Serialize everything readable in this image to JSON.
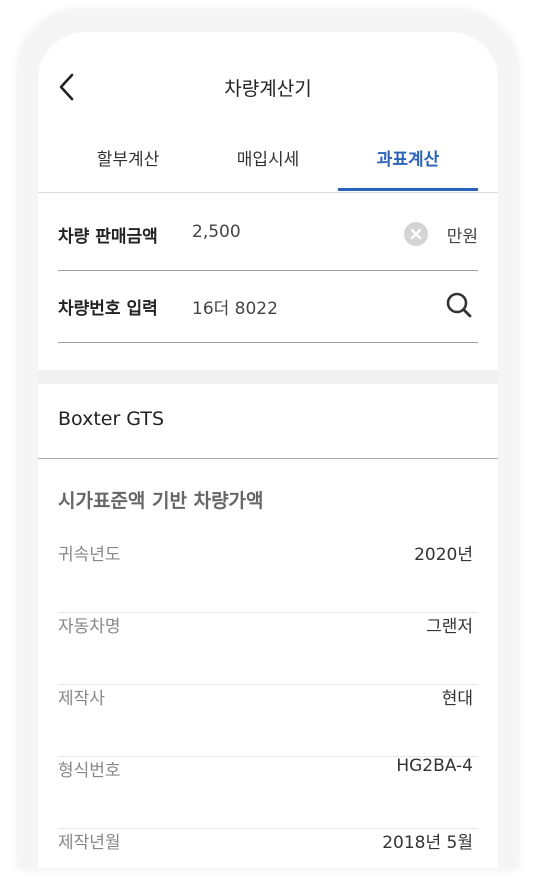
{
  "header": {
    "title": "차량계산기",
    "back_icon": "chevron-left-icon"
  },
  "tabs": [
    {
      "label": "할부계산",
      "active": false
    },
    {
      "label": "매입시세",
      "active": false
    },
    {
      "label": "과표계산",
      "active": true
    }
  ],
  "form": {
    "price": {
      "label": "차량 판매금액",
      "value": "2,500",
      "unit": "만원",
      "clear_icon": "clear-icon"
    },
    "plate": {
      "label": "차량번호 입력",
      "value": "16더 8022",
      "search_icon": "search-icon"
    }
  },
  "result": {
    "car_name": "Boxter GTS",
    "section_title": "시가표준액 기반 차량가액",
    "rows": [
      {
        "label": "귀속년도",
        "value": "2020년"
      },
      {
        "label": "자동차명",
        "value": "그랜저"
      },
      {
        "label": "제작사",
        "value": "현대"
      },
      {
        "label": "형식번호",
        "value": "HG2BA-4"
      },
      {
        "label": "제작년월",
        "value": "2018년 5월"
      }
    ]
  },
  "colors": {
    "accent": "#2a63b8",
    "label_gray": "#888888"
  }
}
